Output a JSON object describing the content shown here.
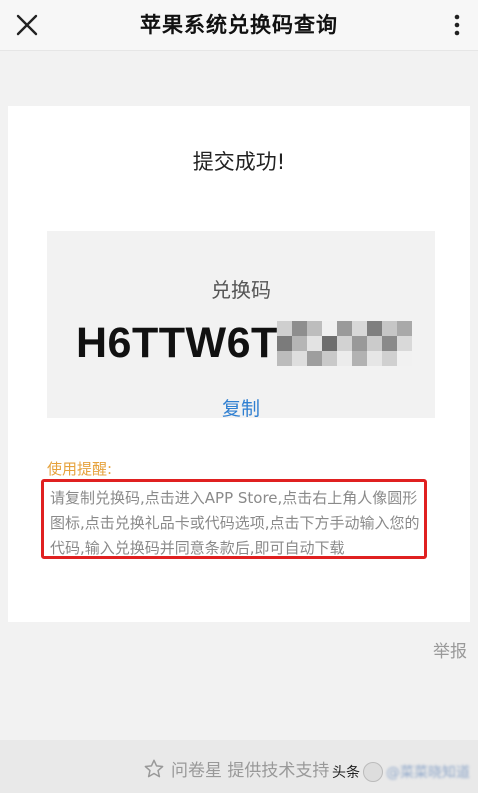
{
  "topbar": {
    "title": "苹果系统兑换码查询",
    "close_icon": "close-icon",
    "more_icon": "more-vertical-icon"
  },
  "card": {
    "success_title": "提交成功!",
    "code_label": "兑换码",
    "code_value_visible": "H6TTW6T",
    "copy_label": "复制"
  },
  "tips": {
    "heading": "使用提醒:",
    "text": "请复制兑换码,点击进入APP Store,点击右上角人像圆形图标,点击兑换礼品卡或代码选项,点击下方手动输入您的代码,输入兑换码并同意条款后,即可自动下载"
  },
  "report_label": "举报",
  "footer": {
    "brand_icon": "star-outline-icon",
    "brand_text": "问卷星 提供技术支持"
  },
  "watermark": {
    "prefix": "头条",
    "suffix": "@菜菜晓知道"
  },
  "colors": {
    "accent_link": "#2f7fd1",
    "tips_heading": "#e6a23c",
    "highlight_border": "#e02020",
    "muted_text": "#8a8a8a"
  }
}
